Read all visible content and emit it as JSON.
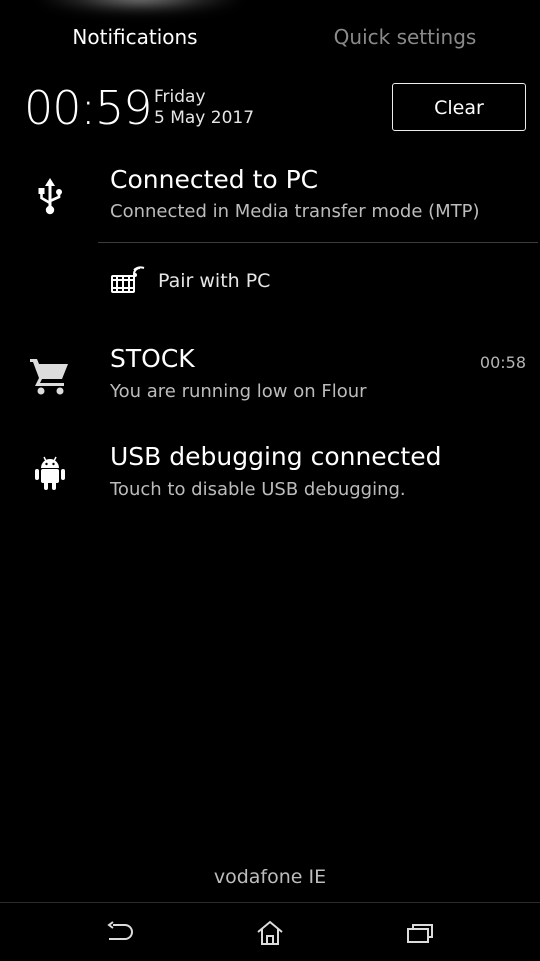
{
  "tabs": {
    "notifications": "Notifications",
    "quick_settings": "Quick settings"
  },
  "clock": {
    "time": "00:59",
    "day": "Friday",
    "date": "5 May 2017"
  },
  "clear_label": "Clear",
  "notifications": [
    {
      "icon": "usb-icon",
      "title": "Connected to PC",
      "text": "Connected in Media transfer mode (MTP)",
      "action": {
        "icon": "pair-with-pc-icon",
        "label": "Pair with PC"
      }
    },
    {
      "icon": "shopping-cart-icon",
      "title": "STOCK",
      "text": "You are running low on Flour",
      "time": "00:58"
    },
    {
      "icon": "android-icon",
      "title": "USB debugging connected",
      "text": "Touch to disable USB debugging."
    }
  ],
  "carrier": "vodafone IE",
  "navbar": {
    "back_icon": "back-icon",
    "home_icon": "home-icon",
    "recents_icon": "recent-apps-icon"
  },
  "colors": {
    "background": "#000000",
    "primary_text": "#ffffff",
    "secondary_text": "#bcbcbc",
    "inactive_tab": "#8a8a8a"
  }
}
